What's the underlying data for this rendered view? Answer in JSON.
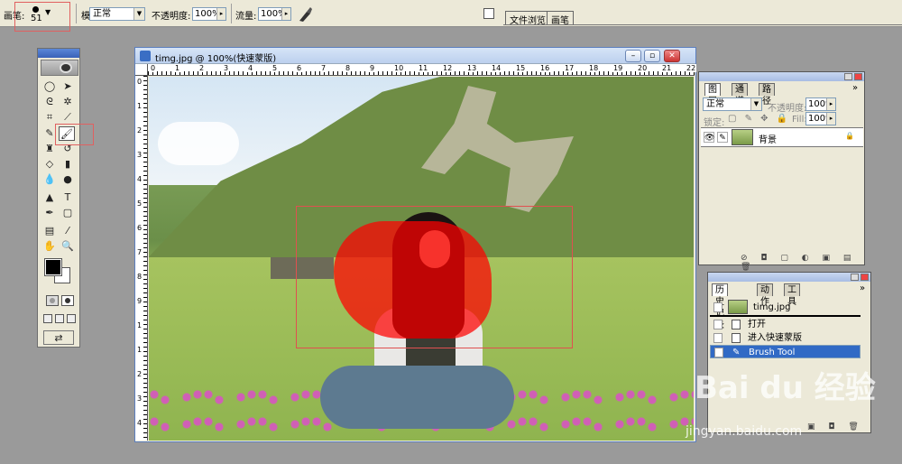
{
  "optionsbar": {
    "brush_label": "画笔:",
    "brush_size": "51",
    "mode_label": "模式:",
    "mode_value": "正常",
    "opacity_label": "不透明度:",
    "opacity_value": "100%",
    "flow_label": "流量:",
    "flow_value": "100%",
    "tabs": [
      "文件浏览",
      "画笔"
    ]
  },
  "document": {
    "title": "timg.jpg @ 100%(快速蒙版)",
    "ruler_h": [
      "0",
      "1",
      "2",
      "3",
      "4",
      "5",
      "6",
      "7",
      "8",
      "9",
      "10",
      "11",
      "12",
      "13",
      "14",
      "15",
      "16",
      "17",
      "18",
      "19",
      "20",
      "21",
      "22"
    ],
    "ruler_v": [
      "0",
      "1",
      "2",
      "3",
      "4",
      "5",
      "6",
      "7",
      "8",
      "9",
      "1",
      "1",
      "2",
      "3",
      "4"
    ]
  },
  "layers_panel": {
    "tabs": [
      "图层",
      "通道",
      "路径"
    ],
    "blend_mode": "正常",
    "opacity_label": "不透明度:",
    "opacity_value": "100%",
    "lock_label": "锁定:",
    "fill_label": "Fill:",
    "fill_value": "100%",
    "layer_name": "背景"
  },
  "history_panel": {
    "tabs": [
      "历史记录",
      "动作",
      "工具"
    ],
    "snapshot": "timg.jpg",
    "items": [
      "打开",
      "进入快速蒙版",
      "Brush Tool"
    ]
  },
  "watermark": {
    "logo": "Bai du 经验",
    "url": "jingyan.baidu.com"
  }
}
